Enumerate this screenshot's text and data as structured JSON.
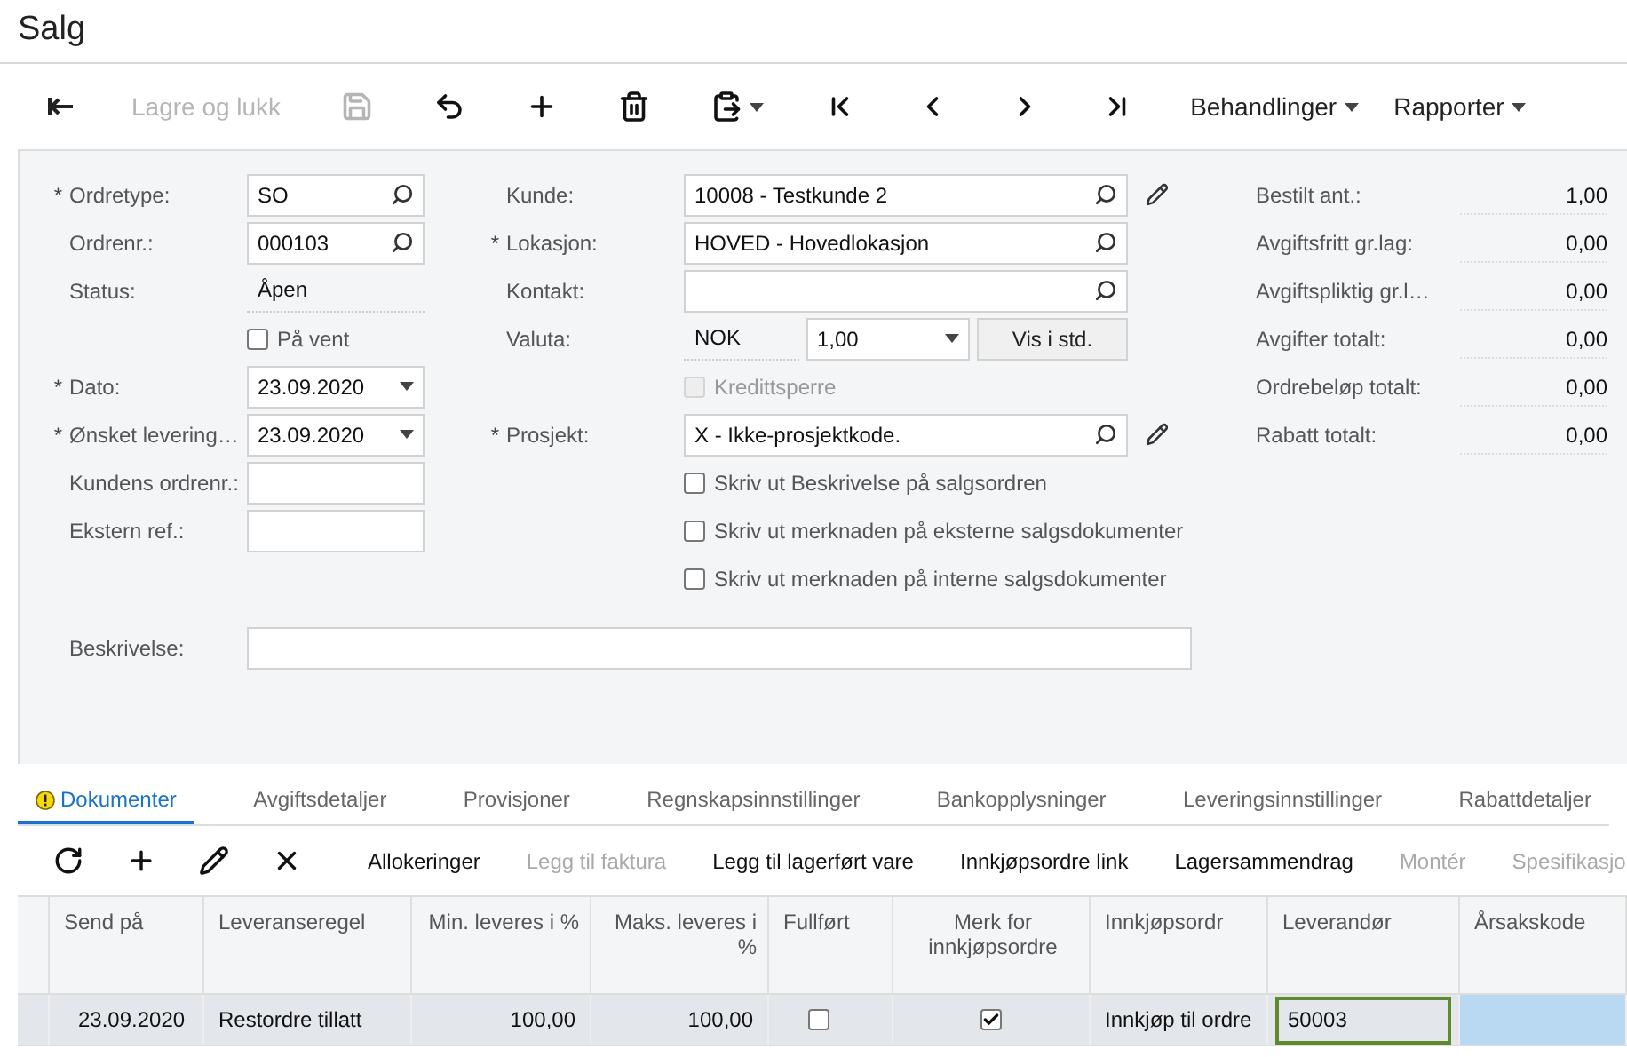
{
  "window": {
    "title": "Salg"
  },
  "toolbar": [
    {
      "kind": "back",
      "disabled": false
    },
    {
      "kind": "text",
      "label": "Lagre og lukk",
      "disabled": true
    },
    {
      "kind": "save",
      "disabled": true
    },
    {
      "kind": "undo",
      "disabled": false
    },
    {
      "kind": "add",
      "disabled": false
    },
    {
      "kind": "delete",
      "disabled": false
    },
    {
      "kind": "paste",
      "disabled": false
    },
    {
      "kind": "first",
      "disabled": false
    },
    {
      "kind": "prev",
      "disabled": false
    },
    {
      "kind": "next",
      "disabled": false
    },
    {
      "kind": "last",
      "disabled": false
    },
    {
      "kind": "menu",
      "label": "Behandlinger",
      "disabled": false
    },
    {
      "kind": "menu",
      "label": "Rapporter",
      "disabled": false
    }
  ],
  "form": {
    "left": [
      {
        "kind": "lookup",
        "required_mark": "*",
        "label": "Ordretype:",
        "value": "SO"
      },
      {
        "kind": "lookup",
        "label": "Ordrenr.:",
        "value": "000103"
      },
      {
        "kind": "display",
        "label": "Status:",
        "value": "Åpen"
      },
      {
        "kind": "checkbox",
        "label": "På vent",
        "checked": false,
        "disabled": false
      },
      {
        "kind": "date",
        "required_mark": "*",
        "label": "Dato:",
        "value": "23.09.2020"
      },
      {
        "kind": "date",
        "required_mark": "*",
        "label": "Ønsket levering…",
        "value": "23.09.2020"
      },
      {
        "kind": "input",
        "label": "Kundens ordrenr.:"
      },
      {
        "kind": "input",
        "label": "Ekstern ref.:"
      }
    ],
    "middle": [
      {
        "kind": "lookup",
        "label": "Kunde:",
        "value": "10008 - Testkunde 2",
        "editable": true
      },
      {
        "kind": "lookup",
        "required_mark": "*",
        "label": "Lokasjon:",
        "value": "HOVED - Hovedlokasjon"
      },
      {
        "kind": "lookup",
        "label": "Kontakt:"
      },
      {
        "kind": "currency",
        "label": "Valuta:",
        "value": "NOK",
        "rate": "1,00",
        "button": "Vis i std."
      },
      {
        "kind": "checkbox",
        "label": "Kredittsperre",
        "checked": false,
        "disabled": true
      },
      {
        "kind": "lookup",
        "required_mark": "*",
        "label": "Prosjekt:",
        "value": "X - Ikke-prosjektkode.",
        "editable": true
      },
      {
        "kind": "checkbox",
        "label": "Skriv ut Beskrivelse på salgsordren",
        "checked": false,
        "disabled": false
      },
      {
        "kind": "checkbox",
        "label": "Skriv ut merknaden på eksterne salgsdokumenter",
        "checked": false,
        "disabled": false
      },
      {
        "kind": "checkbox",
        "label": "Skriv ut merknaden på interne salgsdokumenter",
        "checked": false,
        "disabled": false
      }
    ],
    "totals": [
      {
        "label": "Bestilt ant.:",
        "value": "1,00"
      },
      {
        "label": "Avgiftsfritt gr.lag:",
        "value": "0,00"
      },
      {
        "label": "Avgiftspliktig gr.l…",
        "value": "0,00"
      },
      {
        "label": "Avgifter totalt:",
        "value": "0,00"
      },
      {
        "label": "Ordrebeløp totalt:",
        "value": "0,00"
      },
      {
        "label": "Rabatt totalt:",
        "value": "0,00"
      }
    ],
    "description": {
      "label": "Beskrivelse:"
    }
  },
  "tabs": [
    {
      "label": "Dokumenter",
      "selected": true,
      "warning": true
    },
    {
      "label": "Avgiftsdetaljer",
      "selected": false,
      "warning": false
    },
    {
      "label": "Provisjoner",
      "selected": false,
      "warning": false
    },
    {
      "label": "Regnskapsinnstillinger",
      "selected": false,
      "warning": false
    },
    {
      "label": "Bankopplysninger",
      "selected": false,
      "warning": false
    },
    {
      "label": "Leveringsinnstillinger",
      "selected": false,
      "warning": false
    },
    {
      "label": "Rabattdetaljer",
      "selected": false,
      "warning": false
    }
  ],
  "grid_toolbar": [
    {
      "kind": "refresh",
      "disabled": false
    },
    {
      "kind": "add",
      "disabled": false
    },
    {
      "kind": "edit",
      "disabled": false
    },
    {
      "kind": "remove",
      "disabled": false
    },
    {
      "kind": "text",
      "label": "Allokeringer",
      "disabled": false
    },
    {
      "kind": "text",
      "label": "Legg til faktura",
      "disabled": true
    },
    {
      "kind": "text",
      "label": "Legg til lagerført vare",
      "disabled": false
    },
    {
      "kind": "text",
      "label": "Innkjøpsordre link",
      "disabled": false
    },
    {
      "kind": "text",
      "label": "Lagersammendrag",
      "disabled": false
    },
    {
      "kind": "text",
      "label": "Montér",
      "disabled": true
    },
    {
      "kind": "text",
      "label": "Spesifikasjo",
      "disabled": true
    }
  ],
  "table": {
    "columns": [
      {
        "label": "Send på"
      },
      {
        "label": "Leveranseregel"
      },
      {
        "label": "Min. leveres i %"
      },
      {
        "label": "Maks. leveres i %"
      },
      {
        "label": "Fullført"
      },
      {
        "label": "Merk for innkjøpsordre"
      },
      {
        "label": "Innkjøpsordr"
      },
      {
        "label": "Leverandør"
      },
      {
        "label": "Årsakskode"
      }
    ],
    "rows": [
      {
        "cells": [
          {
            "kind": "text",
            "value": "23.09.2020"
          },
          {
            "kind": "text",
            "value": "Restordre tillatt"
          },
          {
            "kind": "number",
            "value": "100,00"
          },
          {
            "kind": "number",
            "value": "100,00"
          },
          {
            "kind": "checkbox",
            "checked": false
          },
          {
            "kind": "checkbox",
            "checked": true
          },
          {
            "kind": "text",
            "value": "Innkjøp til ordre"
          },
          {
            "kind": "editor",
            "value": "50003"
          },
          {
            "kind": "focus"
          }
        ]
      }
    ]
  }
}
